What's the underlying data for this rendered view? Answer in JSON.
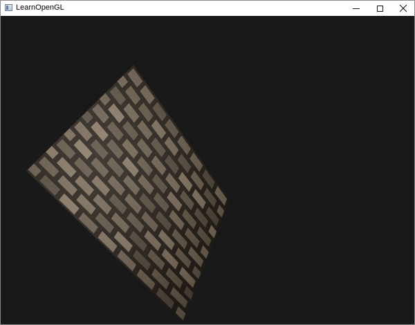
{
  "window": {
    "title": "LearnOpenGL",
    "icon": "app-window-icon",
    "controls": {
      "minimize": "minimize-icon",
      "maximize": "maximize-icon",
      "close": "close-icon"
    }
  },
  "scene": {
    "background_color": "#191919",
    "texture": "cobblestone-brick-texture",
    "object": "rotated-textured-plane",
    "stone_color": "#7a6c5a",
    "mortar_color": "#2e2720"
  }
}
